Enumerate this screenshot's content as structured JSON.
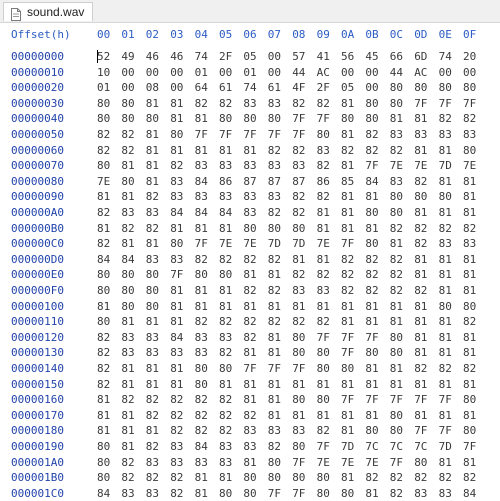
{
  "tab": {
    "label": "sound.wav",
    "icon": "file-icon"
  },
  "header": {
    "offset_label": "Offset(h)",
    "columns": [
      "00",
      "01",
      "02",
      "03",
      "04",
      "05",
      "06",
      "07",
      "08",
      "09",
      "0A",
      "0B",
      "0C",
      "0D",
      "0E",
      "0F"
    ]
  },
  "rows": [
    {
      "offset": "00000000",
      "bytes": [
        "52",
        "49",
        "46",
        "46",
        "74",
        "2F",
        "05",
        "00",
        "57",
        "41",
        "56",
        "45",
        "66",
        "6D",
        "74",
        "20"
      ]
    },
    {
      "offset": "00000010",
      "bytes": [
        "10",
        "00",
        "00",
        "00",
        "01",
        "00",
        "01",
        "00",
        "44",
        "AC",
        "00",
        "00",
        "44",
        "AC",
        "00",
        "00"
      ]
    },
    {
      "offset": "00000020",
      "bytes": [
        "01",
        "00",
        "08",
        "00",
        "64",
        "61",
        "74",
        "61",
        "4F",
        "2F",
        "05",
        "00",
        "80",
        "80",
        "80",
        "80"
      ]
    },
    {
      "offset": "00000030",
      "bytes": [
        "80",
        "80",
        "81",
        "81",
        "82",
        "82",
        "83",
        "83",
        "82",
        "82",
        "81",
        "80",
        "80",
        "7F",
        "7F",
        "7F"
      ]
    },
    {
      "offset": "00000040",
      "bytes": [
        "80",
        "80",
        "80",
        "81",
        "81",
        "80",
        "80",
        "80",
        "7F",
        "7F",
        "80",
        "80",
        "81",
        "81",
        "82",
        "82"
      ]
    },
    {
      "offset": "00000050",
      "bytes": [
        "82",
        "82",
        "81",
        "80",
        "7F",
        "7F",
        "7F",
        "7F",
        "7F",
        "80",
        "81",
        "82",
        "83",
        "83",
        "83",
        "83"
      ]
    },
    {
      "offset": "00000060",
      "bytes": [
        "82",
        "82",
        "81",
        "81",
        "81",
        "81",
        "81",
        "82",
        "82",
        "83",
        "82",
        "82",
        "82",
        "81",
        "81",
        "80"
      ]
    },
    {
      "offset": "00000070",
      "bytes": [
        "80",
        "81",
        "81",
        "82",
        "83",
        "83",
        "83",
        "83",
        "83",
        "82",
        "81",
        "7F",
        "7E",
        "7E",
        "7D",
        "7E"
      ]
    },
    {
      "offset": "00000080",
      "bytes": [
        "7E",
        "80",
        "81",
        "83",
        "84",
        "86",
        "87",
        "87",
        "87",
        "86",
        "85",
        "84",
        "83",
        "82",
        "81",
        "81"
      ]
    },
    {
      "offset": "00000090",
      "bytes": [
        "81",
        "81",
        "82",
        "83",
        "83",
        "83",
        "83",
        "83",
        "82",
        "82",
        "81",
        "81",
        "80",
        "80",
        "80",
        "81"
      ]
    },
    {
      "offset": "000000A0",
      "bytes": [
        "82",
        "83",
        "83",
        "84",
        "84",
        "84",
        "83",
        "82",
        "82",
        "81",
        "81",
        "80",
        "80",
        "81",
        "81",
        "81"
      ]
    },
    {
      "offset": "000000B0",
      "bytes": [
        "81",
        "82",
        "82",
        "81",
        "81",
        "81",
        "80",
        "80",
        "80",
        "81",
        "81",
        "81",
        "82",
        "82",
        "82",
        "82"
      ]
    },
    {
      "offset": "000000C0",
      "bytes": [
        "82",
        "81",
        "81",
        "80",
        "7F",
        "7E",
        "7E",
        "7D",
        "7D",
        "7E",
        "7F",
        "80",
        "81",
        "82",
        "83",
        "83"
      ]
    },
    {
      "offset": "000000D0",
      "bytes": [
        "84",
        "84",
        "83",
        "83",
        "82",
        "82",
        "82",
        "82",
        "81",
        "81",
        "82",
        "82",
        "82",
        "81",
        "81",
        "81"
      ]
    },
    {
      "offset": "000000E0",
      "bytes": [
        "80",
        "80",
        "80",
        "7F",
        "80",
        "80",
        "81",
        "81",
        "82",
        "82",
        "82",
        "82",
        "82",
        "81",
        "81",
        "81"
      ]
    },
    {
      "offset": "000000F0",
      "bytes": [
        "80",
        "80",
        "80",
        "81",
        "81",
        "81",
        "82",
        "82",
        "83",
        "83",
        "82",
        "82",
        "82",
        "82",
        "81",
        "81"
      ]
    },
    {
      "offset": "00000100",
      "bytes": [
        "81",
        "80",
        "80",
        "81",
        "81",
        "81",
        "81",
        "81",
        "81",
        "81",
        "81",
        "81",
        "81",
        "81",
        "80",
        "80"
      ]
    },
    {
      "offset": "00000110",
      "bytes": [
        "80",
        "81",
        "81",
        "81",
        "82",
        "82",
        "82",
        "82",
        "82",
        "82",
        "81",
        "81",
        "81",
        "81",
        "81",
        "82"
      ]
    },
    {
      "offset": "00000120",
      "bytes": [
        "82",
        "83",
        "83",
        "84",
        "83",
        "83",
        "82",
        "81",
        "80",
        "7F",
        "7F",
        "7F",
        "80",
        "81",
        "81",
        "81"
      ]
    },
    {
      "offset": "00000130",
      "bytes": [
        "82",
        "83",
        "83",
        "83",
        "83",
        "82",
        "81",
        "81",
        "80",
        "80",
        "7F",
        "80",
        "80",
        "81",
        "81",
        "81"
      ]
    },
    {
      "offset": "00000140",
      "bytes": [
        "82",
        "81",
        "81",
        "81",
        "80",
        "80",
        "7F",
        "7F",
        "7F",
        "80",
        "80",
        "81",
        "81",
        "82",
        "82",
        "82"
      ]
    },
    {
      "offset": "00000150",
      "bytes": [
        "82",
        "81",
        "81",
        "81",
        "80",
        "81",
        "81",
        "81",
        "81",
        "81",
        "81",
        "81",
        "81",
        "81",
        "81",
        "81"
      ]
    },
    {
      "offset": "00000160",
      "bytes": [
        "81",
        "82",
        "82",
        "82",
        "82",
        "82",
        "81",
        "81",
        "80",
        "80",
        "7F",
        "7F",
        "7F",
        "7F",
        "7F",
        "80"
      ]
    },
    {
      "offset": "00000170",
      "bytes": [
        "81",
        "81",
        "82",
        "82",
        "82",
        "82",
        "82",
        "81",
        "81",
        "81",
        "81",
        "81",
        "80",
        "81",
        "81",
        "81"
      ]
    },
    {
      "offset": "00000180",
      "bytes": [
        "81",
        "81",
        "81",
        "82",
        "82",
        "82",
        "83",
        "83",
        "83",
        "82",
        "81",
        "80",
        "80",
        "7F",
        "7F",
        "80"
      ]
    },
    {
      "offset": "00000190",
      "bytes": [
        "80",
        "81",
        "82",
        "83",
        "84",
        "83",
        "83",
        "82",
        "80",
        "7F",
        "7D",
        "7C",
        "7C",
        "7C",
        "7D",
        "7F"
      ]
    },
    {
      "offset": "000001A0",
      "bytes": [
        "80",
        "82",
        "83",
        "83",
        "83",
        "83",
        "81",
        "80",
        "7F",
        "7E",
        "7E",
        "7E",
        "7F",
        "80",
        "81",
        "81"
      ]
    },
    {
      "offset": "000001B0",
      "bytes": [
        "80",
        "82",
        "82",
        "82",
        "81",
        "81",
        "80",
        "80",
        "80",
        "80",
        "81",
        "82",
        "82",
        "82",
        "82",
        "82"
      ]
    },
    {
      "offset": "000001C0",
      "bytes": [
        "84",
        "83",
        "83",
        "82",
        "81",
        "80",
        "80",
        "7F",
        "7F",
        "80",
        "80",
        "81",
        "82",
        "83",
        "83",
        "84"
      ]
    }
  ]
}
